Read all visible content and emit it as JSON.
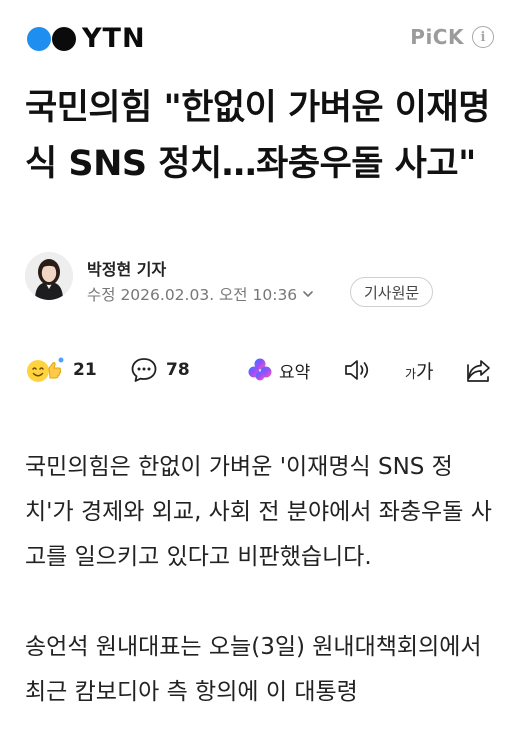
{
  "header": {
    "brand": "YTN",
    "pick_label": "PiCK",
    "info_glyph": "i"
  },
  "article": {
    "title": "국민의힘 \"한없이 가벼운 이재명식 SNS 정치…좌충우돌 사고\"",
    "reporter": "박정현 기자",
    "date": "수정 2026.02.03. 오전 10:36",
    "original_button": "기사원문"
  },
  "actions": {
    "reaction_count": "21",
    "comment_count": "78",
    "summary_label": "요약",
    "font_size_label_small": "가",
    "font_size_label_large": "가"
  },
  "body": {
    "paragraphs": [
      "국민의힘은 한없이 가벼운 '이재명식 SNS 정치'가 경제와 외교, 사회 전 분야에서 좌충우돌 사고를 일으키고 있다고 비판했습니다.",
      "송언석 원내대표는 오늘(3일) 원내대책회의에서 최근 캄보디아 측 항의에 이 대통령"
    ]
  },
  "colors": {
    "brand_blue": "#1e8ef0",
    "brand_black": "#0b0b0b",
    "muted": "#777777"
  }
}
